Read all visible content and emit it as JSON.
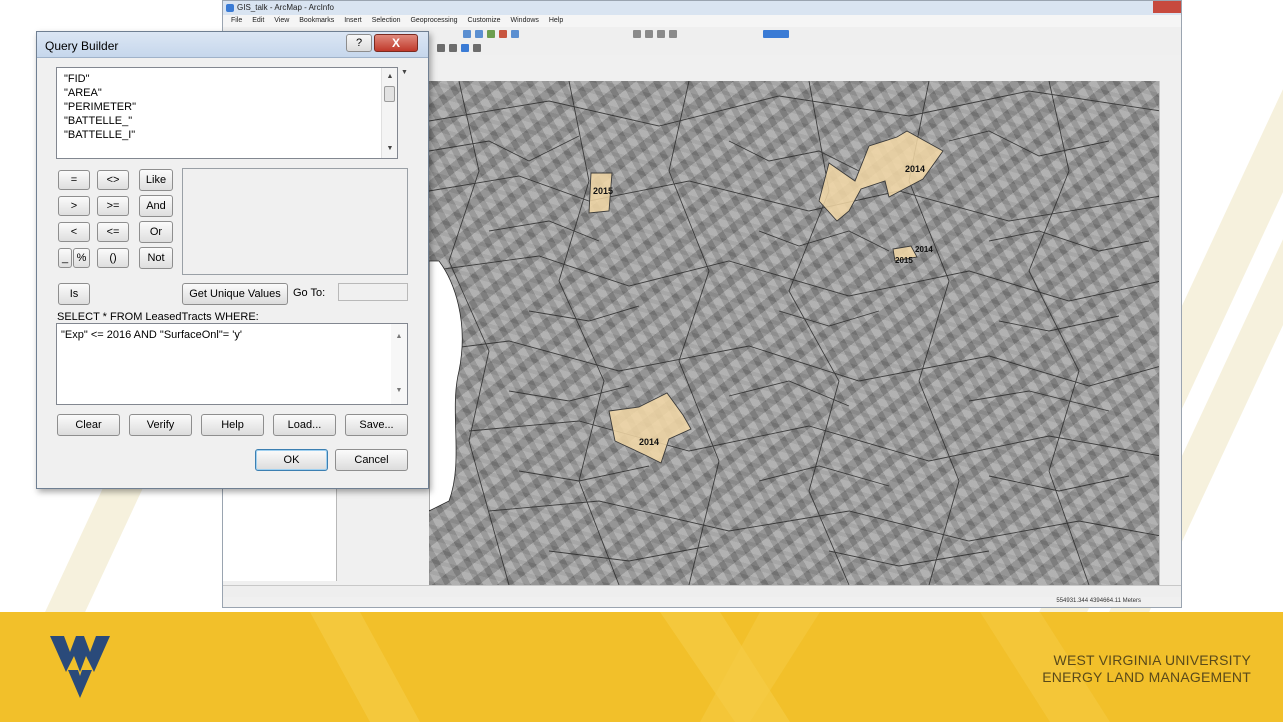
{
  "app": {
    "title": "GIS_talk - ArcMap - ArcInfo",
    "menu": [
      "File",
      "Edit",
      "View",
      "Bookmarks",
      "Insert",
      "Selection",
      "Geoprocessing",
      "Customize",
      "Windows",
      "Help"
    ],
    "status_coordinates": "554931.344  4394664.11 Meters"
  },
  "map": {
    "labels": [
      "2015",
      "2014",
      "2014",
      "2015",
      "2014"
    ],
    "highlight_color": "#f3d8a6"
  },
  "dialog": {
    "title": "Query Builder",
    "help_glyph": "?",
    "close_glyph": "X",
    "fields": [
      "\"FID\"",
      "\"AREA\"",
      "\"PERIMETER\"",
      "\"BATTELLE_\"",
      "\"BATTELLE_I\""
    ],
    "operators": {
      "equals": "=",
      "not_equal": "<>",
      "like": "Like",
      "greater": ">",
      "greater_equal": ">=",
      "and": "And",
      "less": "<",
      "less_equal": "<=",
      "or": "Or",
      "underscore": "_",
      "percent": "%",
      "parens": "()",
      "not": "Not",
      "is": "Is"
    },
    "get_unique_values": "Get Unique Values",
    "go_to_label": "Go To:",
    "sql_prefix": "SELECT * FROM LeasedTracts WHERE:",
    "expression": "\"Exp\" <= 2016 AND \"SurfaceOnl\"= 'y'",
    "buttons": {
      "clear": "Clear",
      "verify": "Verify",
      "help": "Help",
      "load": "Load...",
      "save": "Save...",
      "ok": "OK",
      "cancel": "Cancel"
    }
  },
  "footer": {
    "line1": "WEST VIRGINIA UNIVERSITY",
    "line2": "ENERGY LAND MANAGEMENT",
    "bg_color": "#f2c02a",
    "logo_color": "#2a4a7a"
  }
}
